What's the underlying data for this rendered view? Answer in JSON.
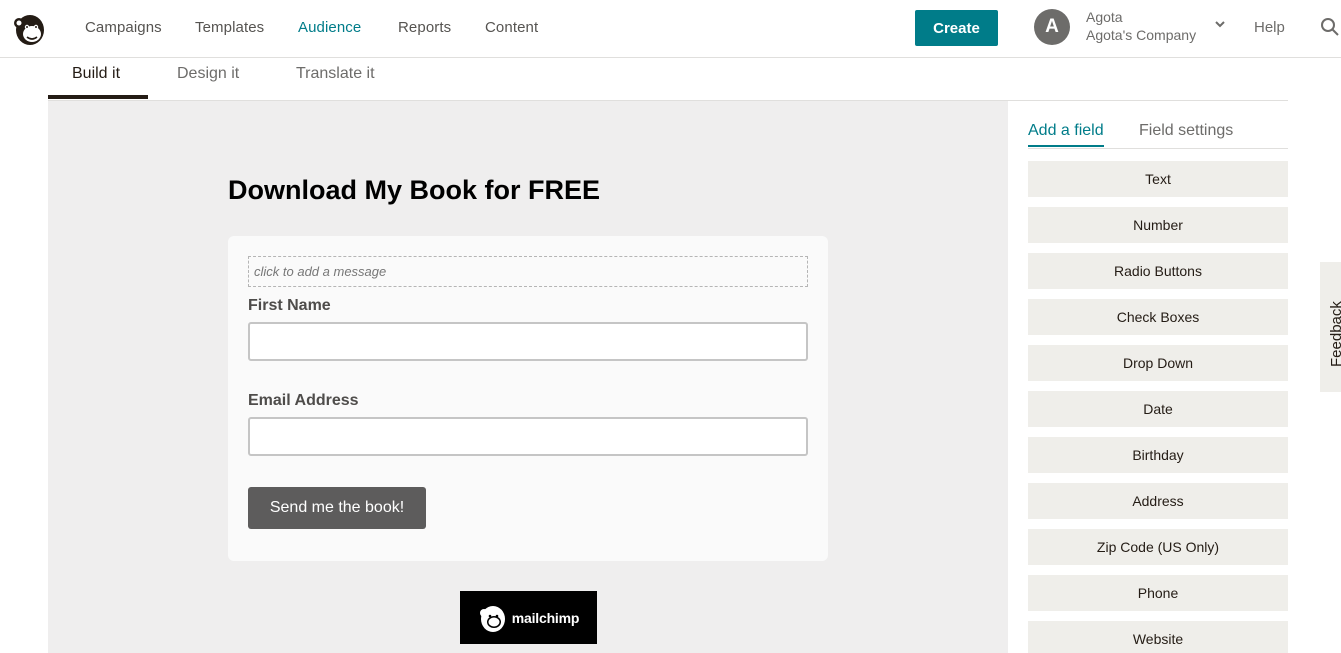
{
  "nav": {
    "items": [
      {
        "label": "Campaigns",
        "active": false
      },
      {
        "label": "Templates",
        "active": false
      },
      {
        "label": "Audience",
        "active": true
      },
      {
        "label": "Reports",
        "active": false
      },
      {
        "label": "Content",
        "active": false
      }
    ],
    "create_label": "Create",
    "account": {
      "initial": "A",
      "name": "Agota",
      "company": "Agota's Company"
    },
    "help_label": "Help"
  },
  "builder_tabs": [
    "Build it",
    "Design it",
    "Translate it"
  ],
  "form": {
    "title": "Download My Book for FREE",
    "message_placeholder": "click to add a message",
    "fields": [
      {
        "label": "First Name",
        "value": ""
      },
      {
        "label": "Email Address",
        "value": ""
      }
    ],
    "submit_label": "Send me the book!",
    "badge_text": "mailchimp"
  },
  "sidebar": {
    "tabs": [
      "Add a field",
      "Field settings"
    ],
    "active_tab": "Add a field",
    "field_types": [
      "Text",
      "Number",
      "Radio Buttons",
      "Check Boxes",
      "Drop Down",
      "Date",
      "Birthday",
      "Address",
      "Zip Code (US Only)",
      "Phone",
      "Website"
    ]
  },
  "feedback_label": "Feedback",
  "colors": {
    "accent": "#007c89",
    "submit": "#5d5c5c",
    "canvas": "#efeeee"
  }
}
